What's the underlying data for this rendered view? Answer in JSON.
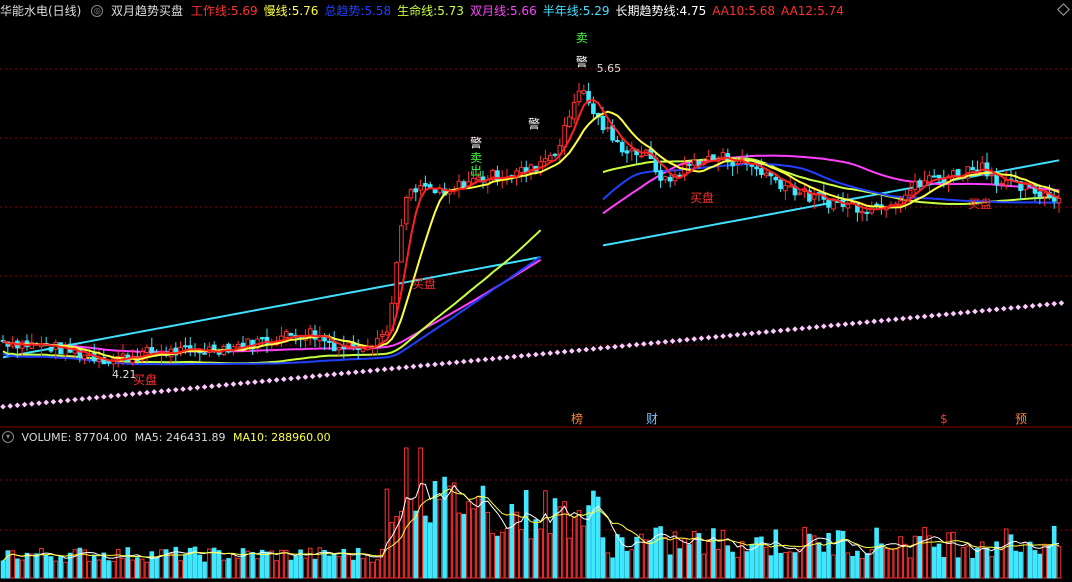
{
  "header": {
    "stock": "华能水电(日线)",
    "indicator_name": "双月趋势买盘",
    "lines": [
      {
        "label": "工作线:",
        "value": "5.69",
        "color": "#ff3030"
      },
      {
        "label": "慢线:",
        "value": "5.76",
        "color": "#ffff40"
      },
      {
        "label": "总趋势:",
        "value": "5.58",
        "color": "#2040ff"
      },
      {
        "label": "生命线:",
        "value": "5.73",
        "color": "#c8ff40"
      },
      {
        "label": "双月线:",
        "value": "5.66",
        "color": "#ff40ff"
      },
      {
        "label": "半年线:",
        "value": "5.29",
        "color": "#40e0ff"
      },
      {
        "label": "长期趋势线:",
        "value": "4.75",
        "color": "#ffffff"
      },
      {
        "label": "AA10:",
        "value": "5.68",
        "color": "#ff3030"
      },
      {
        "label": "AA12:",
        "value": "5.74",
        "color": "#ff3030"
      }
    ]
  },
  "volume_header": {
    "volume": "VOLUME: 87704.00",
    "ma5": "MA5: 246431.89",
    "ma10": "MA10: 288960.00",
    "ma10_color": "#ffff40"
  },
  "colors": {
    "up": "#ff3030",
    "down": "#40e8ff",
    "work": "#ff2020",
    "slow": "#ffff40",
    "trend": "#2040ff",
    "life": "#c8ff40",
    "month": "#ff40ff",
    "half": "#40e0ff",
    "long": "#ffc8ff",
    "grid": "#8b0000"
  },
  "annotations": {
    "sell": "卖",
    "warn": "警",
    "out": "出",
    "buy": "买盘",
    "high": "5.65",
    "low": "4.21",
    "bang": "榜",
    "cai": "财",
    "dollar": "$",
    "yu": "预"
  },
  "chart_data": {
    "type": "candlestick",
    "title": "华能水电(日线)",
    "indicator": "双月趋势买盘",
    "price_high_label": 5.65,
    "price_low_label": 4.21,
    "lines": [
      "工作线",
      "慢线",
      "总趋势",
      "生命线",
      "双月线",
      "半年线",
      "长期趋势线",
      "AA10",
      "AA12"
    ],
    "last_values": {
      "工作线": 5.69,
      "慢线": 5.76,
      "总趋势": 5.58,
      "生命线": 5.73,
      "双月线": 5.66,
      "半年线": 5.29,
      "长期趋势线": 4.75,
      "AA10": 5.68,
      "AA12": 5.74
    },
    "volume": {
      "last": 87704.0,
      "ma5": 246431.89,
      "ma10": 288960.0
    }
  }
}
